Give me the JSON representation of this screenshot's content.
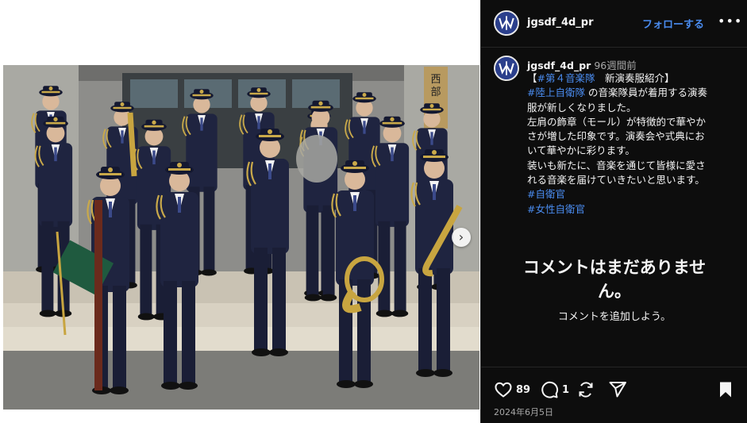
{
  "header": {
    "username": "jgsdf_4d_pr",
    "follow_label": "フォローする",
    "more_icon": "more-horizontal-icon"
  },
  "caption": {
    "username": "jgsdf_4d_pr",
    "time_ago": "96週間前",
    "lines": [
      {
        "segments": [
          {
            "text": "【",
            "tag": false
          },
          {
            "text": "#第４音楽隊",
            "tag": true
          },
          {
            "text": "　新演奏服紹介】",
            "tag": false
          }
        ]
      },
      {
        "segments": [
          {
            "text": "#陸上自衛隊",
            "tag": true
          },
          {
            "text": " の音楽隊員が着用する演奏",
            "tag": false
          }
        ]
      },
      {
        "segments": [
          {
            "text": "服が新しくなりました。",
            "tag": false
          }
        ]
      },
      {
        "segments": [
          {
            "text": "左肩の飾章（モール）が特徴的で華やか",
            "tag": false
          }
        ]
      },
      {
        "segments": [
          {
            "text": "さが増した印象です。演奏会や式典にお",
            "tag": false
          }
        ]
      },
      {
        "segments": [
          {
            "text": "いて華やかに彩ります。",
            "tag": false
          }
        ]
      },
      {
        "segments": [
          {
            "text": "装いも新たに、音楽を通じて皆様に愛さ",
            "tag": false
          }
        ]
      },
      {
        "segments": [
          {
            "text": "れる音楽を届けていきたいと思います。",
            "tag": false
          }
        ]
      },
      {
        "segments": [
          {
            "text": "#自衛官",
            "tag": true
          }
        ]
      },
      {
        "segments": [
          {
            "text": "#女性自衛官",
            "tag": true
          }
        ]
      }
    ]
  },
  "comments": {
    "empty_title": "コメントはまだありませ\nん。",
    "empty_title_line1": "コメントはまだありませ",
    "empty_title_line2": "ん。",
    "empty_subtitle": "コメントを追加しよう。"
  },
  "actions": {
    "like_icon": "heart-icon",
    "like_count": "89",
    "comment_icon": "comment-icon",
    "comment_count": "1",
    "repost_icon": "repost-icon",
    "share_icon": "share-icon",
    "save_icon": "bookmark-icon"
  },
  "post_date": "2024年6月5日",
  "media": {
    "alt": "陸上自衛隊 第4音楽隊 新演奏服 集合写真",
    "carousel_next_icon": "chevron-right-icon",
    "building_sign": "西部"
  },
  "colors": {
    "panel_bg": "#0d0d0d",
    "link_blue": "#4a8cf0",
    "uniform_navy": "#1f2440",
    "braid_gold": "#c9a94a"
  }
}
